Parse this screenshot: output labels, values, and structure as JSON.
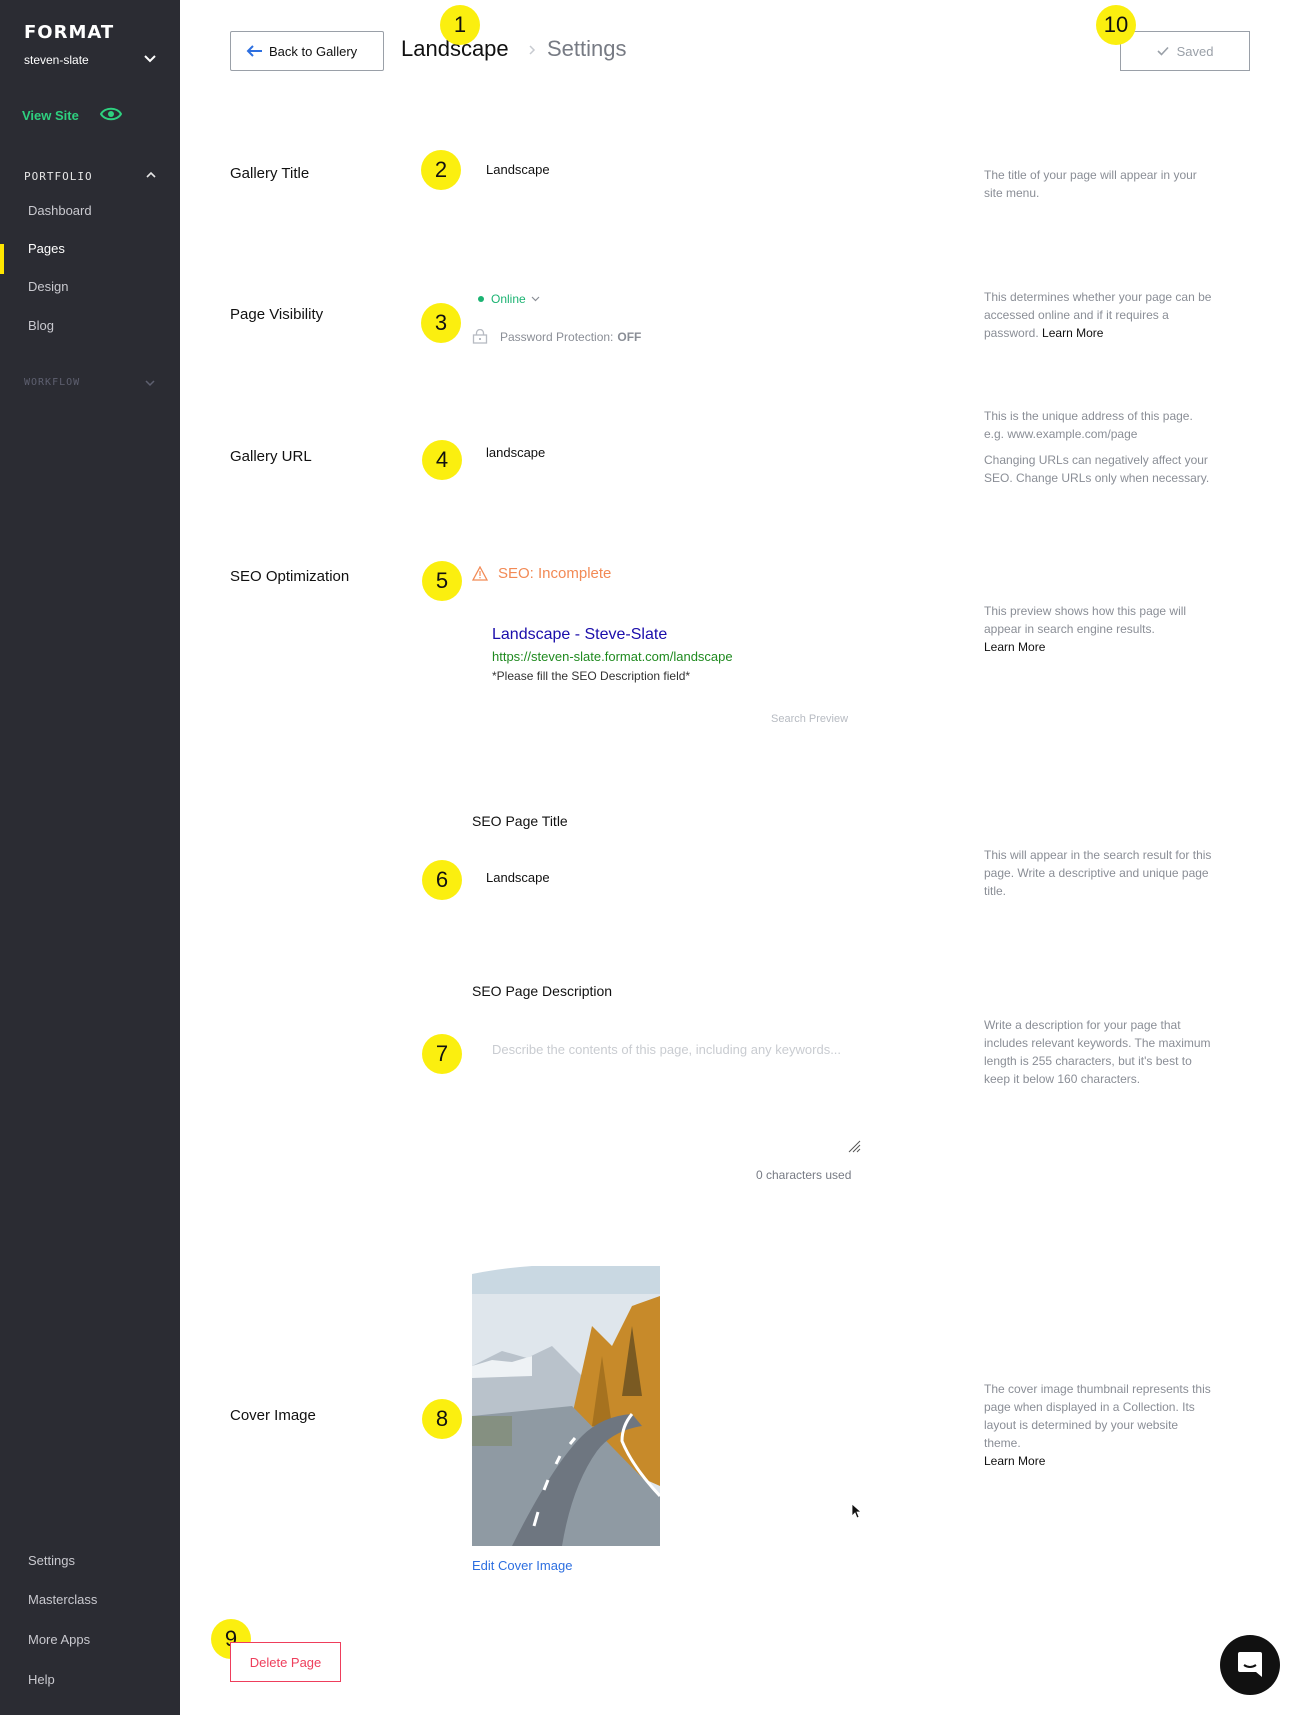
{
  "sidebar": {
    "brand": "FORMAT",
    "account": "steven-slate",
    "view_site": "View Site",
    "portfolio_heading": "PORTFOLIO",
    "items": [
      {
        "label": "Dashboard"
      },
      {
        "label": "Pages",
        "active": true
      },
      {
        "label": "Design"
      },
      {
        "label": "Blog"
      }
    ],
    "workflow_heading": "WORKFLOW",
    "bottom_items": [
      {
        "label": "Settings"
      },
      {
        "label": "Masterclass"
      },
      {
        "label": "More Apps"
      },
      {
        "label": "Help"
      }
    ],
    "accent_color": "#2ed07f",
    "active_marker_color": "#ffe600"
  },
  "header": {
    "back_label": "Back to Gallery",
    "crumb_main": "Landscape",
    "crumb_sub": "Settings",
    "saved_label": "Saved"
  },
  "callouts": [
    "1",
    "2",
    "3",
    "4",
    "5",
    "6",
    "7",
    "8",
    "9",
    "10"
  ],
  "callout_color": "#fbef0f",
  "gallery_title": {
    "label": "Gallery Title",
    "value": "Landscape",
    "help": "The title of your page will appear in your site menu."
  },
  "visibility": {
    "label": "Page Visibility",
    "status": "Online",
    "password_label": "Password Protection:",
    "password_value": "OFF",
    "help": "This determines whether your page can be accessed online and if it requires a password.",
    "help_link": "Learn More"
  },
  "url": {
    "label": "Gallery URL",
    "value": "landscape",
    "help1": "This is the unique address of this page. e.g. www.example.com/page",
    "help2": "Changing URLs can negatively affect your SEO. Change URLs only when necessary."
  },
  "seo": {
    "label": "SEO Optimization",
    "status": "SEO: Incomplete",
    "preview_title": "Landscape - Steve-Slate",
    "preview_url": "https://steven-slate.format.com/landscape",
    "preview_desc": "*Please fill the SEO Description field*",
    "preview_caption": "Search Preview",
    "help": "This preview shows how this page will appear in search engine results.",
    "help_link": "Learn More"
  },
  "seo_title": {
    "label": "SEO Page Title",
    "value": "Landscape",
    "help": "This will appear in the search result for this page. Write a descriptive and unique page title."
  },
  "seo_desc": {
    "label": "SEO Page Description",
    "placeholder": "Describe the contents of this page, including any keywords...",
    "char_count": "0 characters used",
    "help": "Write a description for your page that includes relevant keywords. The maximum length is 255 characters, but it's best to keep it below 160 characters."
  },
  "cover": {
    "label": "Cover Image",
    "edit_label": "Edit Cover Image",
    "help": "The cover image thumbnail represents this page when displayed in a Collection. Its layout is determined by your website theme.",
    "help_link": "Learn More"
  },
  "delete_label": "Delete Page",
  "colors": {
    "online": "#1bb372",
    "warning": "#f28a55",
    "link": "#2d6fe0",
    "danger": "#ee3e5c"
  }
}
